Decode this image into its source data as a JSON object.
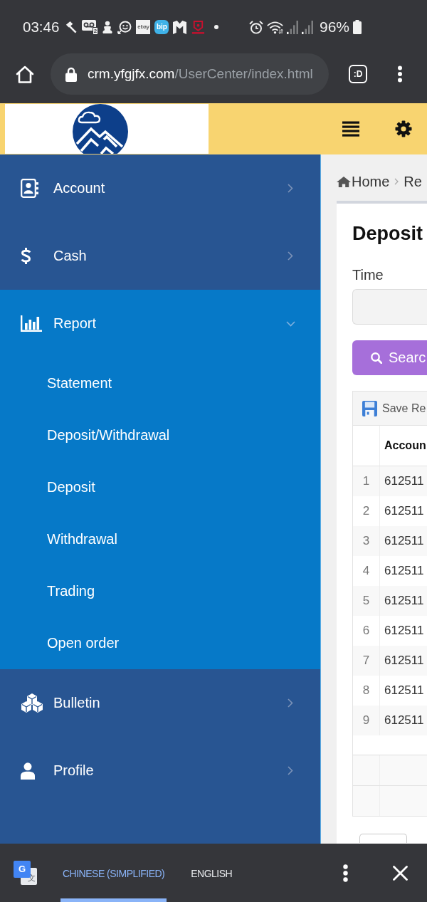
{
  "status_bar": {
    "time": "03:46",
    "notifications": [
      {
        "kind": "hammer"
      },
      {
        "kind": "voicemail",
        "count": "2"
      },
      {
        "kind": "person"
      },
      {
        "kind": "smiley"
      },
      {
        "kind": "tile",
        "label": "ebay"
      },
      {
        "kind": "bubble",
        "label": "bip"
      },
      {
        "kind": "gate"
      },
      {
        "kind": "shield"
      },
      {
        "kind": "dot"
      }
    ],
    "battery": "96%"
  },
  "browser": {
    "url": {
      "host": "crm.yfgjfx.com",
      "path": "/UserCenter/index.html"
    },
    "tab_switcher": ":D"
  },
  "sidebar": {
    "items": [
      {
        "label": "Account",
        "expanded": false
      },
      {
        "label": "Cash",
        "expanded": false
      },
      {
        "label": "Report",
        "expanded": true,
        "children": [
          {
            "label": "Statement"
          },
          {
            "label": "Deposit/Withdrawal"
          },
          {
            "label": "Deposit"
          },
          {
            "label": "Withdrawal"
          },
          {
            "label": "Trading"
          },
          {
            "label": "Open order"
          }
        ]
      },
      {
        "label": "Bulletin",
        "expanded": false
      },
      {
        "label": "Profile",
        "expanded": false
      }
    ]
  },
  "content": {
    "breadcrumb": [
      "Home",
      "Re"
    ],
    "title": "Deposit",
    "filter": {
      "label": "Time"
    },
    "search_button": "Searc",
    "table": {
      "toolbar_button": "Save Re",
      "columns": [
        "",
        "Accoun"
      ],
      "rows": [
        [
          "1",
          "612511"
        ],
        [
          "2",
          "612511"
        ],
        [
          "3",
          "612511"
        ],
        [
          "4",
          "612511"
        ],
        [
          "5",
          "612511"
        ],
        [
          "6",
          "612511"
        ],
        [
          "7",
          "612511"
        ],
        [
          "8",
          "612511"
        ],
        [
          "9",
          "612511"
        ]
      ]
    }
  },
  "translate_bar": {
    "logo": {
      "letter": "G",
      "glyph": "文"
    },
    "languages": [
      {
        "label": "CHINESE (SIMPLIFIED)",
        "selected": true
      },
      {
        "label": "ENGLISH",
        "selected": false
      }
    ]
  }
}
